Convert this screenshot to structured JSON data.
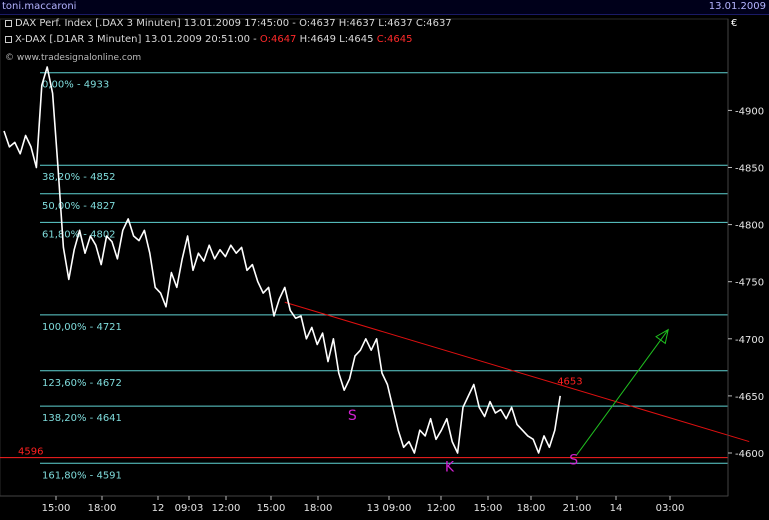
{
  "header": {
    "user": "toni.maccaroni",
    "date": "13.01.2009"
  },
  "legend": {
    "row1": "DAX Perf. Index [.DAX  3 Minuten] 13.01.2009 17:45:00 - O:4637 H:4637 L:4637 C:4637",
    "row2_a": "X-DAX [.D1AR  3 Minuten] 13.01.2009 20:51:00 - ",
    "row2_o": "O:4647",
    "row2_b": " H:4649 L:4645 ",
    "row2_c": "C:4645"
  },
  "watermark": "© www.tradesignalonline.com",
  "currency_symbol": "€",
  "colors": {
    "background": "#000000",
    "price": "#ffffff",
    "fib": "#5fd3d3",
    "fib_label": "#7fdcdc",
    "trendline": "#e01010",
    "support": "#ff2020",
    "arrow": "#20c020",
    "pattern": "#d020d0",
    "axis_text": "#e6e6e6",
    "header": "#00001a"
  },
  "chart_data": {
    "type": "line",
    "ylim": [
      4574,
      4950
    ],
    "yticks": [
      4600,
      4650,
      4700,
      4750,
      4800,
      4850,
      4900
    ],
    "xtick_labels": [
      "15:00",
      "18:00",
      "12",
      "09:03",
      "12:00",
      "15:00",
      "18:00",
      "13 09:00",
      "12:00",
      "15:00",
      "18:00",
      "21:00",
      "14",
      "03:00"
    ],
    "fib_levels": [
      {
        "label": "0,00% - 4933",
        "value": 4933
      },
      {
        "label": "38,20% - 4852",
        "value": 4852
      },
      {
        "label": "50,00% - 4827",
        "value": 4827
      },
      {
        "label": "61,80% - 4802",
        "value": 4802
      },
      {
        "label": "100,00% - 4721",
        "value": 4721
      },
      {
        "label": "123,60% - 4672",
        "value": 4672
      },
      {
        "label": "138,20% - 4641",
        "value": 4641
      },
      {
        "label": "161,80% - 4591",
        "value": 4591
      }
    ],
    "support": {
      "label": "4596",
      "value": 4596
    },
    "last_price": {
      "label": "4653",
      "value": 4653
    },
    "pattern_labels": [
      {
        "text": "S",
        "x": 64.5,
        "value": 4629
      },
      {
        "text": "K",
        "x": 82.5,
        "value": 4584
      },
      {
        "text": "S",
        "x": 105.5,
        "value": 4590
      }
    ],
    "trendline": [
      {
        "x": 52,
        "y": 4732
      },
      {
        "x": 138,
        "y": 4610
      }
    ],
    "projection": [
      {
        "x": 106,
        "y": 4598
      },
      {
        "x": 123,
        "y": 4708
      }
    ],
    "price_series": [
      {
        "x": 0,
        "y": 4882
      },
      {
        "x": 1,
        "y": 4868
      },
      {
        "x": 2,
        "y": 4872
      },
      {
        "x": 3,
        "y": 4862
      },
      {
        "x": 4,
        "y": 4878
      },
      {
        "x": 5,
        "y": 4868
      },
      {
        "x": 6,
        "y": 4850
      },
      {
        "x": 7,
        "y": 4922
      },
      {
        "x": 8,
        "y": 4938
      },
      {
        "x": 9,
        "y": 4915
      },
      {
        "x": 10,
        "y": 4850
      },
      {
        "x": 11,
        "y": 4780
      },
      {
        "x": 12,
        "y": 4752
      },
      {
        "x": 13,
        "y": 4778
      },
      {
        "x": 14,
        "y": 4795
      },
      {
        "x": 15,
        "y": 4775
      },
      {
        "x": 16,
        "y": 4790
      },
      {
        "x": 17,
        "y": 4782
      },
      {
        "x": 18,
        "y": 4765
      },
      {
        "x": 19,
        "y": 4790
      },
      {
        "x": 20,
        "y": 4785
      },
      {
        "x": 21,
        "y": 4770
      },
      {
        "x": 22,
        "y": 4795
      },
      {
        "x": 23,
        "y": 4805
      },
      {
        "x": 24,
        "y": 4790
      },
      {
        "x": 25,
        "y": 4786
      },
      {
        "x": 26,
        "y": 4795
      },
      {
        "x": 27,
        "y": 4775
      },
      {
        "x": 28,
        "y": 4745
      },
      {
        "x": 29,
        "y": 4740
      },
      {
        "x": 30,
        "y": 4728
      },
      {
        "x": 31,
        "y": 4758
      },
      {
        "x": 32,
        "y": 4745
      },
      {
        "x": 33,
        "y": 4770
      },
      {
        "x": 34,
        "y": 4790
      },
      {
        "x": 35,
        "y": 4760
      },
      {
        "x": 36,
        "y": 4775
      },
      {
        "x": 37,
        "y": 4768
      },
      {
        "x": 38,
        "y": 4782
      },
      {
        "x": 39,
        "y": 4770
      },
      {
        "x": 40,
        "y": 4778
      },
      {
        "x": 41,
        "y": 4772
      },
      {
        "x": 42,
        "y": 4782
      },
      {
        "x": 43,
        "y": 4775
      },
      {
        "x": 44,
        "y": 4780
      },
      {
        "x": 45,
        "y": 4760
      },
      {
        "x": 46,
        "y": 4765
      },
      {
        "x": 47,
        "y": 4750
      },
      {
        "x": 48,
        "y": 4740
      },
      {
        "x": 49,
        "y": 4745
      },
      {
        "x": 50,
        "y": 4720
      },
      {
        "x": 51,
        "y": 4735
      },
      {
        "x": 52,
        "y": 4745
      },
      {
        "x": 53,
        "y": 4725
      },
      {
        "x": 54,
        "y": 4718
      },
      {
        "x": 55,
        "y": 4720
      },
      {
        "x": 56,
        "y": 4700
      },
      {
        "x": 57,
        "y": 4710
      },
      {
        "x": 58,
        "y": 4695
      },
      {
        "x": 59,
        "y": 4705
      },
      {
        "x": 60,
        "y": 4680
      },
      {
        "x": 61,
        "y": 4700
      },
      {
        "x": 62,
        "y": 4670
      },
      {
        "x": 63,
        "y": 4655
      },
      {
        "x": 64,
        "y": 4665
      },
      {
        "x": 65,
        "y": 4685
      },
      {
        "x": 66,
        "y": 4690
      },
      {
        "x": 67,
        "y": 4700
      },
      {
        "x": 68,
        "y": 4690
      },
      {
        "x": 69,
        "y": 4700
      },
      {
        "x": 70,
        "y": 4670
      },
      {
        "x": 71,
        "y": 4660
      },
      {
        "x": 72,
        "y": 4640
      },
      {
        "x": 73,
        "y": 4620
      },
      {
        "x": 74,
        "y": 4605
      },
      {
        "x": 75,
        "y": 4610
      },
      {
        "x": 76,
        "y": 4600
      },
      {
        "x": 77,
        "y": 4620
      },
      {
        "x": 78,
        "y": 4615
      },
      {
        "x": 79,
        "y": 4630
      },
      {
        "x": 80,
        "y": 4612
      },
      {
        "x": 81,
        "y": 4620
      },
      {
        "x": 82,
        "y": 4630
      },
      {
        "x": 83,
        "y": 4610
      },
      {
        "x": 84,
        "y": 4600
      },
      {
        "x": 85,
        "y": 4640
      },
      {
        "x": 86,
        "y": 4650
      },
      {
        "x": 87,
        "y": 4660
      },
      {
        "x": 88,
        "y": 4640
      },
      {
        "x": 89,
        "y": 4632
      },
      {
        "x": 90,
        "y": 4645
      },
      {
        "x": 91,
        "y": 4635
      },
      {
        "x": 92,
        "y": 4638
      },
      {
        "x": 93,
        "y": 4630
      },
      {
        "x": 94,
        "y": 4640
      },
      {
        "x": 95,
        "y": 4625
      },
      {
        "x": 96,
        "y": 4620
      },
      {
        "x": 97,
        "y": 4615
      },
      {
        "x": 98,
        "y": 4612
      },
      {
        "x": 99,
        "y": 4600
      },
      {
        "x": 100,
        "y": 4615
      },
      {
        "x": 101,
        "y": 4605
      },
      {
        "x": 102,
        "y": 4620
      },
      {
        "x": 103,
        "y": 4650
      }
    ]
  }
}
